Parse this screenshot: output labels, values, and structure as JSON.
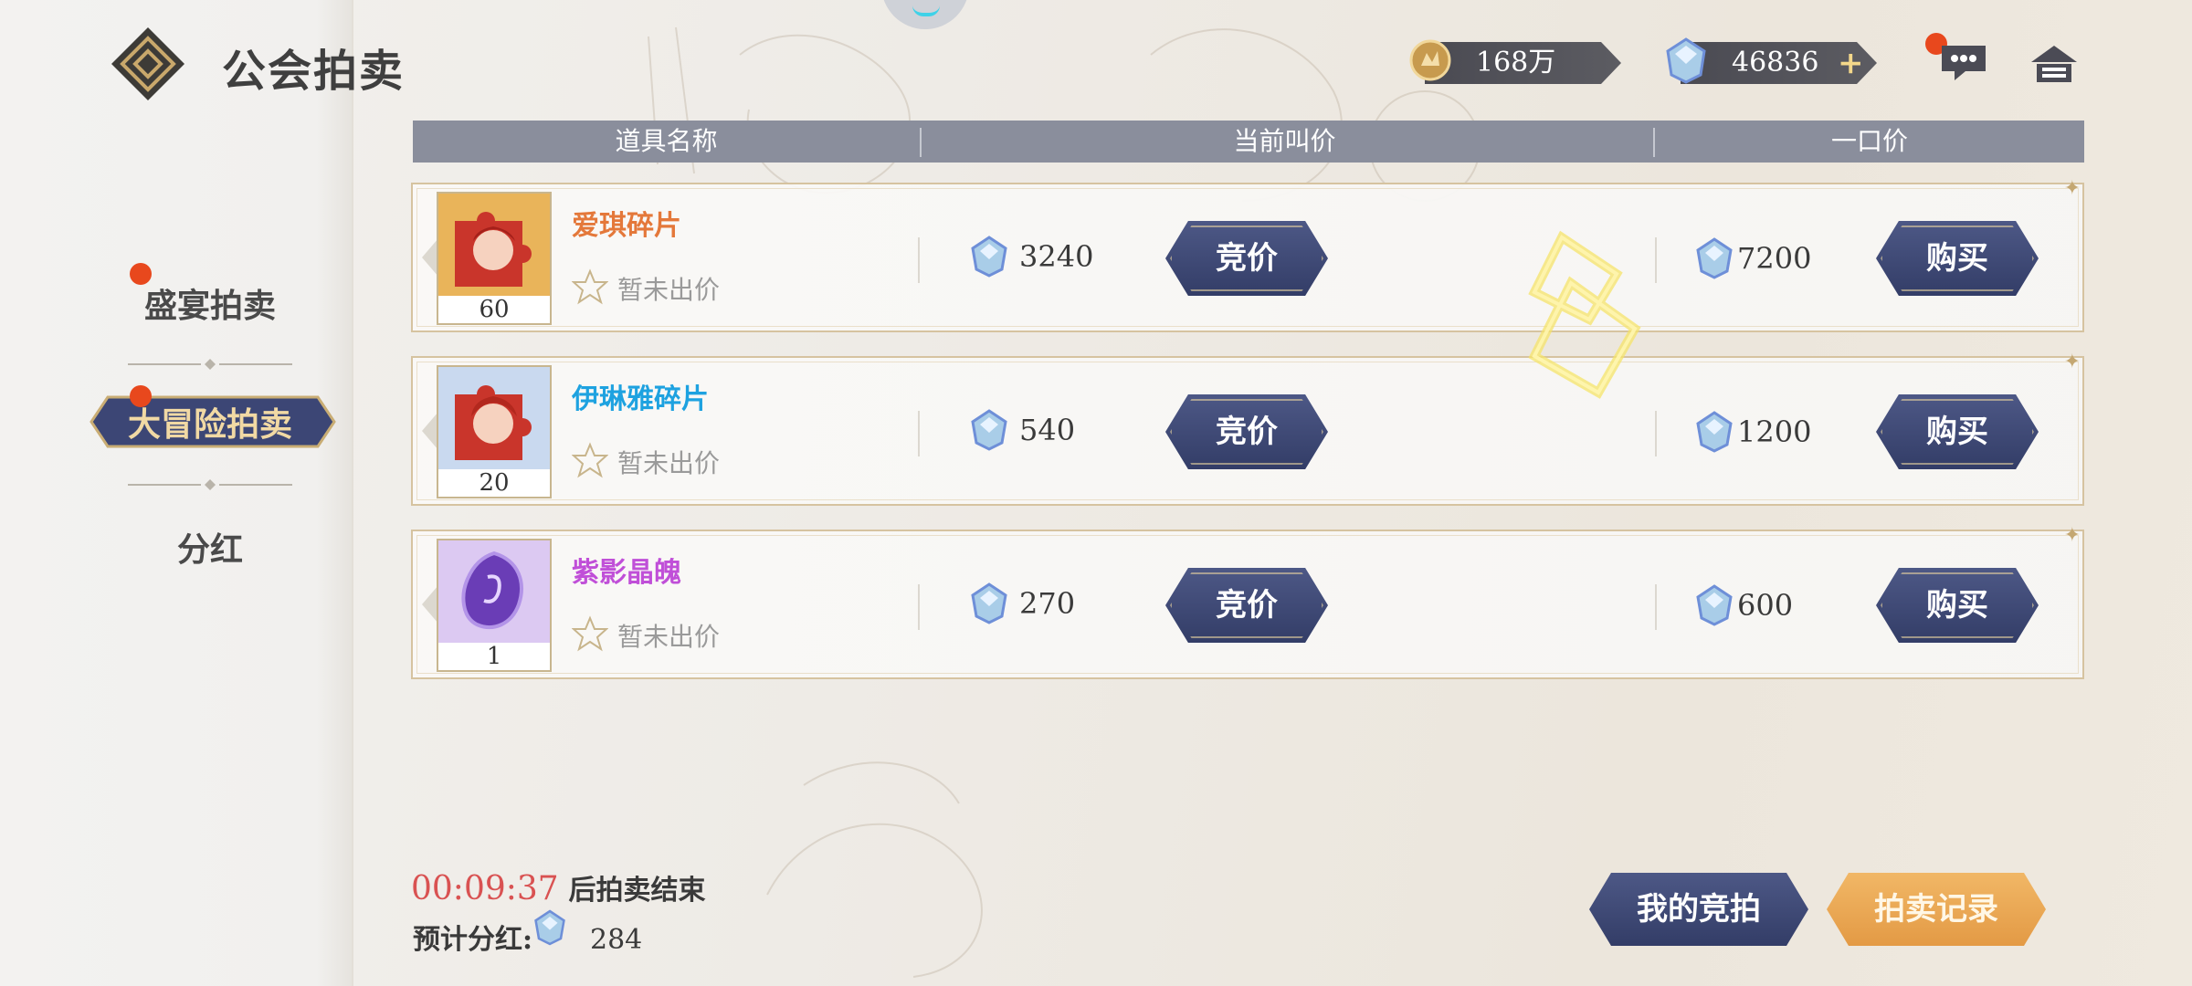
{
  "header": {
    "title": "公会拍卖",
    "gold_amount": "168万",
    "gem_amount": "46836",
    "gem_plus": "+"
  },
  "nav": {
    "items": [
      {
        "label": "盛宴拍卖",
        "active": false,
        "badge": true
      },
      {
        "label": "大冒险拍卖",
        "active": true,
        "badge": true
      },
      {
        "label": "分红",
        "active": false,
        "badge": false
      }
    ]
  },
  "table": {
    "headers": [
      "道具名称",
      "当前叫价",
      "一口价"
    ],
    "rows": [
      {
        "name": "爱琪碎片",
        "name_color": "#e4783a",
        "qty": "60",
        "status": "暂未出价",
        "current_bid": "3240",
        "bid_label": "竞价",
        "buyout": "7200",
        "buy_label": "购买"
      },
      {
        "name": "伊琳雅碎片",
        "name_color": "#1ea2e0",
        "qty": "20",
        "status": "暂未出价",
        "current_bid": "540",
        "bid_label": "竞价",
        "buyout": "1200",
        "buy_label": "购买"
      },
      {
        "name": "紫影晶魄",
        "name_color": "#c04fd8",
        "qty": "1",
        "status": "暂未出价",
        "current_bid": "270",
        "bid_label": "竞价",
        "buyout": "600",
        "buy_label": "购买"
      }
    ]
  },
  "footer": {
    "timer": "00:09:37",
    "timer_suffix": "后拍卖结束",
    "bonus_label": "预计分红:",
    "bonus_value": "284",
    "my_bids_label": "我的竞拍",
    "records_label": "拍卖记录"
  },
  "colors": {
    "accent_button": "#3c4675",
    "orange_button": "#eaa651",
    "badge": "#e8481d",
    "timer": "#d95252"
  }
}
